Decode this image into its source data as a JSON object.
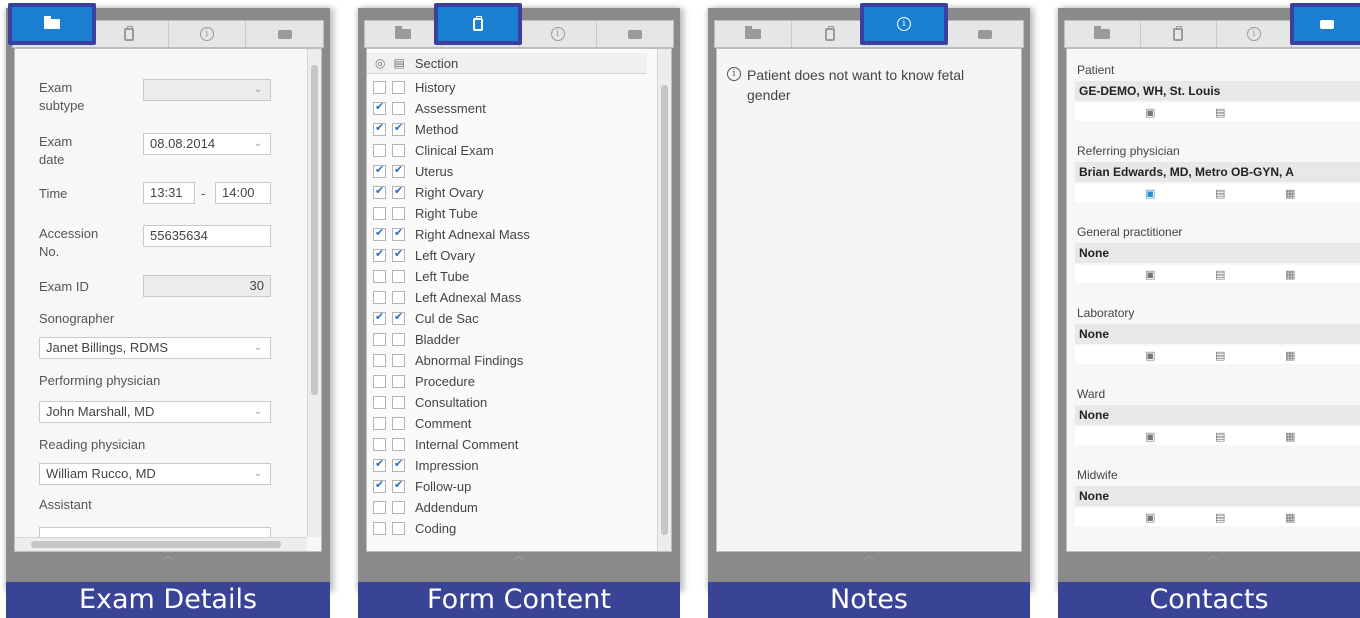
{
  "captions": {
    "exam_details": "Exam Details",
    "form_content": "Form Content",
    "notes": "Notes",
    "contacts": "Contacts"
  },
  "tab_icons": [
    "folder-icon",
    "clipboard-icon",
    "info-icon",
    "mail-icon"
  ],
  "exam_details": {
    "subtype_label": "Exam subtype",
    "subtype_value": "",
    "date_label": "Exam date",
    "date_value": "08.08.2014",
    "time_label": "Time",
    "time_start": "13:31",
    "time_sep": "-",
    "time_end": "14:00",
    "accession_label": "Accession No.",
    "accession_value": "55635634",
    "exam_id_label": "Exam ID",
    "exam_id_value": "30",
    "sonographer_label": "Sonographer",
    "sonographer_value": "Janet Billings, RDMS",
    "performing_label": "Performing physician",
    "performing_value": "John Marshall, MD",
    "reading_label": "Reading physician",
    "reading_value": "William Rucco, MD",
    "assistant_label": "Assistant",
    "assistant_value": ""
  },
  "form_content": {
    "header_label": "Section",
    "rows": [
      {
        "label": "History",
        "vis": false,
        "print": false
      },
      {
        "label": "Assessment",
        "vis": true,
        "print": false
      },
      {
        "label": "Method",
        "vis": true,
        "print": true
      },
      {
        "label": "Clinical Exam",
        "vis": false,
        "print": false
      },
      {
        "label": "Uterus",
        "vis": true,
        "print": true
      },
      {
        "label": "Right Ovary",
        "vis": true,
        "print": true
      },
      {
        "label": "Right Tube",
        "vis": false,
        "print": false
      },
      {
        "label": "Right Adnexal Mass",
        "vis": true,
        "print": true
      },
      {
        "label": "Left Ovary",
        "vis": true,
        "print": true
      },
      {
        "label": "Left Tube",
        "vis": false,
        "print": false
      },
      {
        "label": "Left Adnexal Mass",
        "vis": false,
        "print": false
      },
      {
        "label": "Cul de Sac",
        "vis": true,
        "print": true
      },
      {
        "label": "Bladder",
        "vis": false,
        "print": false
      },
      {
        "label": "Abnormal Findings",
        "vis": false,
        "print": false
      },
      {
        "label": "Procedure",
        "vis": false,
        "print": false
      },
      {
        "label": "Consultation",
        "vis": false,
        "print": false
      },
      {
        "label": "Comment",
        "vis": false,
        "print": false
      },
      {
        "label": "Internal Comment",
        "vis": false,
        "print": false
      },
      {
        "label": "Impression",
        "vis": true,
        "print": true
      },
      {
        "label": "Follow-up",
        "vis": true,
        "print": true
      },
      {
        "label": "Addendum",
        "vis": false,
        "print": false
      },
      {
        "label": "Coding",
        "vis": false,
        "print": false
      }
    ]
  },
  "notes": {
    "text": "Patient does not want to know fetal gender"
  },
  "contacts": {
    "items": [
      {
        "label": "Patient",
        "value": "GE-DEMO, WH, St. Louis"
      },
      {
        "label": "Referring physician",
        "value": "Brian Edwards, MD, Metro OB-GYN, A"
      },
      {
        "label": "General practitioner",
        "value": "None"
      },
      {
        "label": "Laboratory",
        "value": "None"
      },
      {
        "label": "Ward",
        "value": "None"
      },
      {
        "label": "Midwife",
        "value": "None"
      }
    ]
  },
  "colors": {
    "active_tab": "#1a7fd0",
    "caption_bg": "#3a4496",
    "ring": "#3b3f9e"
  }
}
